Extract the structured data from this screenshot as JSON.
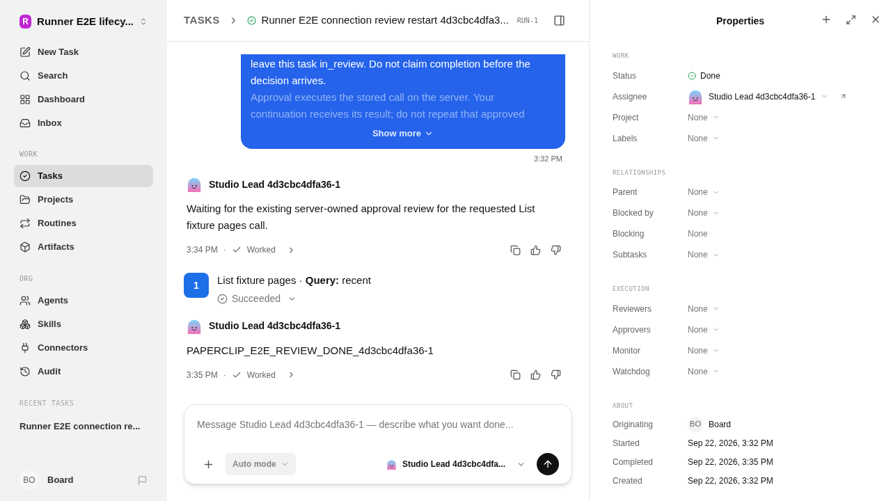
{
  "workspace": {
    "initial": "R",
    "name": "Runner E2E lifecy..."
  },
  "nav": [
    {
      "label": "New Task"
    },
    {
      "label": "Search"
    },
    {
      "label": "Dashboard"
    },
    {
      "label": "Inbox"
    }
  ],
  "sections": [
    {
      "heading": "WORK",
      "items": [
        {
          "label": "Tasks",
          "selected": true
        },
        {
          "label": "Projects",
          "selected": false
        },
        {
          "label": "Routines",
          "selected": false
        },
        {
          "label": "Artifacts",
          "selected": false
        }
      ]
    },
    {
      "heading": "ORG",
      "items": [
        {
          "label": "Agents",
          "selected": false
        },
        {
          "label": "Skills",
          "selected": false
        },
        {
          "label": "Connectors",
          "selected": false
        },
        {
          "label": "Audit",
          "selected": false
        }
      ]
    }
  ],
  "recent_tasks": {
    "heading": "RECENT TASKS",
    "items": [
      "Runner E2E connection re..."
    ]
  },
  "user": {
    "initials": "BO",
    "name": "Board"
  },
  "header": {
    "breadcrumb": "TASKS",
    "title": "Runner E2E connection review restart 4d3cbc4dfa3...",
    "run_id": "RUN-1"
  },
  "messages": [
    {
      "kind": "user",
      "lines": [
        "leave this task in_review. Do not claim completion before the decision arrives."
      ],
      "faded_lines": [
        "Approval executes the stored call on the server. Your continuation receives its result; do not repeat that approved"
      ],
      "show_more": "Show more",
      "time": "3:32 PM"
    },
    {
      "kind": "agent",
      "author": "Studio Lead 4d3cbc4dfa36-1",
      "text": "Waiting for the existing server-owned approval review for the requested List fixture pages call.",
      "time": "3:34 PM",
      "separator": "·",
      "status": "Worked"
    },
    {
      "kind": "tool",
      "number": "1",
      "text": "List fixture pages · **Query:** recent",
      "status": "Succeeded"
    },
    {
      "kind": "agent",
      "author": "Studio Lead 4d3cbc4dfa36-1",
      "text": "PAPERCLIP_E2E_REVIEW_DONE_4d3cbc4dfa36-1",
      "time": "3:35 PM",
      "separator": "·",
      "status": "Worked"
    }
  ],
  "composer": {
    "placeholder": "Message Studio Lead 4d3cbc4dfa36-1 — describe what you want done...",
    "mode": "Auto mode",
    "agent": "Studio Lead 4d3cbc4dfa..."
  },
  "properties": {
    "title": "Properties",
    "sections": [
      {
        "heading": "WORK",
        "rows": [
          {
            "label": "Status",
            "kind": "status",
            "value": "Done"
          },
          {
            "label": "Assignee",
            "kind": "agent",
            "value": "Studio Lead 4d3cbc4dfa36-1"
          },
          {
            "label": "Project",
            "kind": "select",
            "value": "None"
          },
          {
            "label": "Labels",
            "kind": "select",
            "value": "None"
          }
        ]
      },
      {
        "heading": "RELATIONSHIPS",
        "rows": [
          {
            "label": "Parent",
            "kind": "select",
            "value": "None"
          },
          {
            "label": "Blocked by",
            "kind": "select",
            "value": "None"
          },
          {
            "label": "Blocking",
            "kind": "text",
            "value": "None"
          },
          {
            "label": "Subtasks",
            "kind": "select",
            "value": "None"
          }
        ]
      },
      {
        "heading": "EXECUTION",
        "rows": [
          {
            "label": "Reviewers",
            "kind": "select",
            "value": "None"
          },
          {
            "label": "Approvers",
            "kind": "select",
            "value": "None"
          },
          {
            "label": "Monitor",
            "kind": "select",
            "value": "None"
          },
          {
            "label": "Watchdog",
            "kind": "select",
            "value": "None"
          }
        ]
      },
      {
        "heading": "ABOUT",
        "rows": [
          {
            "label": "Originating",
            "kind": "user",
            "initials": "BO",
            "value": "Board"
          },
          {
            "label": "Started",
            "kind": "date",
            "value": "Sep 22, 2026, 3:32 PM"
          },
          {
            "label": "Completed",
            "kind": "date",
            "value": "Sep 22, 2026, 3:35 PM"
          },
          {
            "label": "Created",
            "kind": "date",
            "value": "Sep 22, 2026, 3:32 PM"
          }
        ]
      }
    ]
  }
}
